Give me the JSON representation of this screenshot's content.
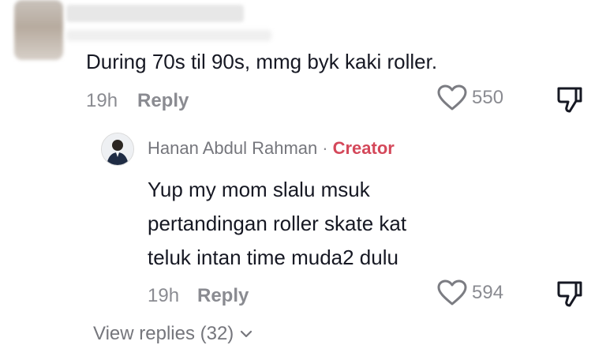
{
  "comment": {
    "text": "During 70s til 90s, mmg byk kaki roller.",
    "time": "19h",
    "reply_label": "Reply",
    "likes": "550"
  },
  "reply": {
    "author": "Hanan Abdul Rahman",
    "separator": "·",
    "badge": "Creator",
    "text_lines": [
      "Yup my mom slalu msuk",
      "pertandingan roller skate kat",
      "teluk intan time muda2 dulu"
    ],
    "time": "19h",
    "reply_label": "Reply",
    "likes": "594"
  },
  "view_replies": {
    "label": "View replies (32)"
  },
  "icons": {
    "like": "heart-outline-icon",
    "dislike": "thumbs-down-icon",
    "expand": "chevron-down-icon"
  },
  "colors": {
    "text_primary": "#161823",
    "text_secondary": "#8a8b91",
    "creator_badge": "#d4485a"
  }
}
